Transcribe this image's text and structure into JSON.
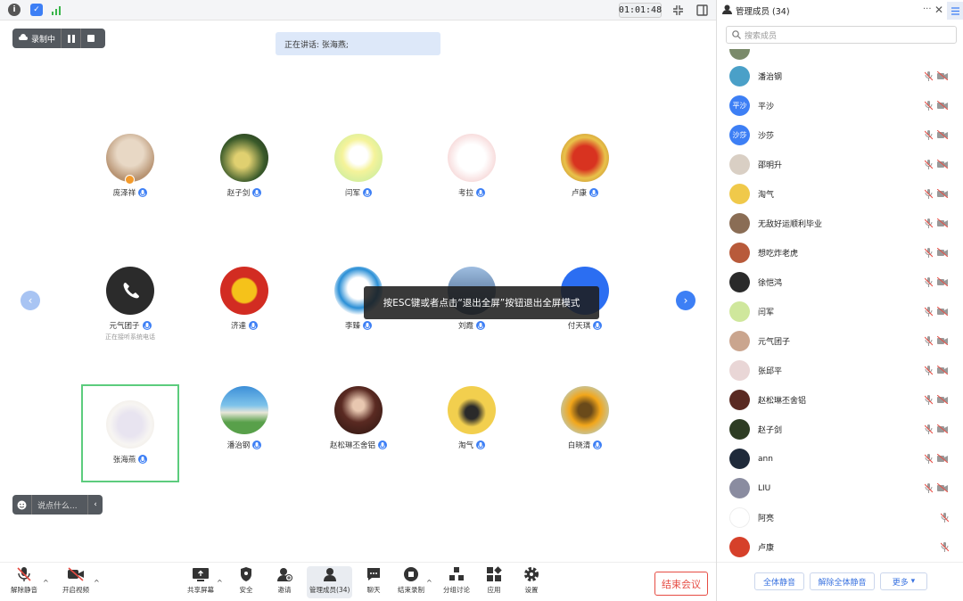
{
  "topbar": {
    "timer": "01:01:48"
  },
  "recording": {
    "label": "录制中"
  },
  "speaking": {
    "text": "正在讲话: 张海燕;"
  },
  "toast": {
    "text": "按ESC键或者点击“退出全屏”按钮退出全屏模式"
  },
  "chat": {
    "placeholder": "说点什么..."
  },
  "tiles": [
    {
      "name": "庞泽祥",
      "avatar": "cat-with-bow",
      "host": true
    },
    {
      "name": "赵子剑",
      "avatar": "anime-girl"
    },
    {
      "name": "闫军",
      "avatar": "cockatoo"
    },
    {
      "name": "考拉",
      "avatar": "cartoon-bunny"
    },
    {
      "name": "卢康",
      "avatar": "red-maple-leaf"
    },
    {
      "name": "元气团子",
      "avatar": "phone-icon",
      "sub": "正在接听系统电话"
    },
    {
      "name": "济達",
      "avatar": "dragon-logo"
    },
    {
      "name": "李臻",
      "avatar": "doraemon"
    },
    {
      "name": "刘霞",
      "avatar": "blue-photo"
    },
    {
      "name": "付天琪",
      "avatar": "blue-text-avatar"
    },
    {
      "name": "张海燕",
      "avatar": "sketch-plate",
      "active": true
    },
    {
      "name": "潘治钢",
      "avatar": "beach-landscape"
    },
    {
      "name": "赵松琳丕舍铝",
      "avatar": "person-photo"
    },
    {
      "name": "淘气",
      "avatar": "cartoon-girl"
    },
    {
      "name": "白晓清",
      "avatar": "sunflower"
    }
  ],
  "toolbar": {
    "mute": "解除静音",
    "video": "开启视频",
    "share": "共享屏幕",
    "security": "安全",
    "invite": "邀请",
    "members": "管理成员(34)",
    "chat": "聊天",
    "record": "结束录制",
    "breakout": "分组讨论",
    "apps": "应用",
    "settings": "设置",
    "end": "结束会议"
  },
  "sidebar": {
    "title": "管理成员 (34)",
    "search_placeholder": "搜索成员",
    "members": [
      {
        "name": "潘治钢",
        "color": "#4aa0c8",
        "text": "",
        "video": true
      },
      {
        "name": "平沙",
        "color": "#3d7ff5",
        "text": "平沙",
        "video": true
      },
      {
        "name": "沙莎",
        "color": "#3d7ff5",
        "text": "沙莎",
        "video": true
      },
      {
        "name": "邵明升",
        "color": "#d9cfc4",
        "text": "",
        "video": true
      },
      {
        "name": "淘气",
        "color": "#f0c94a",
        "text": "",
        "video": true
      },
      {
        "name": "无敌好运顺利毕业",
        "color": "#8a6d55",
        "text": "",
        "video": true
      },
      {
        "name": "想吃炸老虎",
        "color": "#b85a3a",
        "text": "",
        "video": true
      },
      {
        "name": "徐恺鸿",
        "color": "#2a2a2a",
        "text": "",
        "video": true
      },
      {
        "name": "闫军",
        "color": "#cfe79c",
        "text": "",
        "video": true
      },
      {
        "name": "元气团子",
        "color": "#caa58e",
        "text": "",
        "video": true
      },
      {
        "name": "张邱平",
        "color": "#e9d6d6",
        "text": "",
        "video": true
      },
      {
        "name": "赵松琳丕舍铝",
        "color": "#5a2a22",
        "text": "",
        "video": true
      },
      {
        "name": "赵子剑",
        "color": "#2e3d24",
        "text": "",
        "video": true
      },
      {
        "name": "ann",
        "color": "#1f2a3a",
        "text": "",
        "video": true
      },
      {
        "name": "LIU",
        "color": "#8a8ca0",
        "text": "",
        "video": true
      },
      {
        "name": "阿亮",
        "color": "#ffffff",
        "text": "",
        "video": false
      },
      {
        "name": "卢康",
        "color": "#d6402a",
        "text": "",
        "video": false
      }
    ],
    "mute_all": "全体静音",
    "unmute_all": "解除全体静音",
    "more": "更多"
  }
}
